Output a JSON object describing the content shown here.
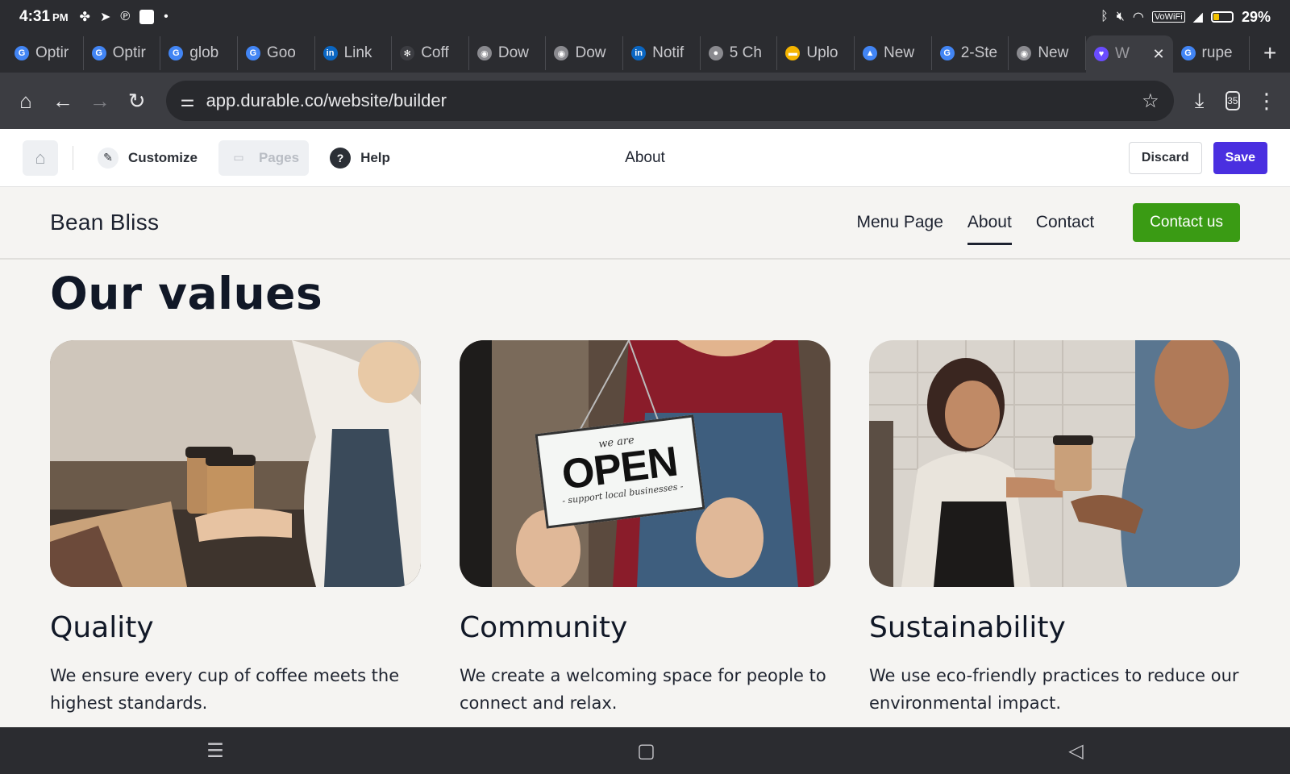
{
  "status": {
    "time": "4:31",
    "ampm": "PM",
    "battery": "29%",
    "wifi_label": "VoWiFi"
  },
  "tabs": [
    {
      "label": "Optir",
      "icon": "google-g-icon",
      "color": "#4285f4"
    },
    {
      "label": "Optir",
      "icon": "google-g-icon",
      "color": "#4285f4"
    },
    {
      "label": "glob",
      "icon": "google-g-icon",
      "color": "#4285f4"
    },
    {
      "label": "Goo",
      "icon": "google-g-icon",
      "color": "#4285f4"
    },
    {
      "label": "Link",
      "icon": "linkedin-icon",
      "color": "#0a66c2"
    },
    {
      "label": "Coff",
      "icon": "leaf-icon",
      "color": "#3c3d42"
    },
    {
      "label": "Dow",
      "icon": "chrome-icon",
      "color": "#8a8a8f"
    },
    {
      "label": "Dow",
      "icon": "chrome-icon",
      "color": "#8a8a8f"
    },
    {
      "label": "Notif",
      "icon": "linkedin-icon",
      "color": "#0a66c2"
    },
    {
      "label": "5 Ch",
      "icon": "globe-icon",
      "color": "#8a8a8f"
    },
    {
      "label": "Uplo",
      "icon": "slides-icon",
      "color": "#f4b400"
    },
    {
      "label": "New",
      "icon": "ads-icon",
      "color": "#4285f4"
    },
    {
      "label": "2-Ste",
      "icon": "google-g-icon",
      "color": "#4285f4"
    },
    {
      "label": "New",
      "icon": "chrome-icon",
      "color": "#8a8a8f"
    },
    {
      "label": "W",
      "icon": "durable-icon",
      "color": "#6a4cff",
      "active": true
    },
    {
      "label": "rupe",
      "icon": "google-g-icon",
      "color": "#4285f4"
    }
  ],
  "address": {
    "url": "app.durable.co/website/builder",
    "tab_count": "35"
  },
  "builder": {
    "customize": "Customize",
    "pages": "Pages",
    "help": "Help",
    "current_page": "About",
    "discard": "Discard",
    "save": "Save"
  },
  "site": {
    "brand": "Bean Bliss",
    "nav": [
      "Menu Page",
      "About",
      "Contact"
    ],
    "active_nav": "About",
    "cta": "Contact us",
    "section_title": "Our values",
    "sign": {
      "top": "we are",
      "main": "OPEN",
      "bottom": "- support local businesses -"
    },
    "cards": [
      {
        "title": "Quality",
        "text": "We ensure every cup of coffee meets the highest standards."
      },
      {
        "title": "Community",
        "text": "We create a welcoming space for people to connect and relax."
      },
      {
        "title": "Sustainability",
        "text": "We use eco-friendly practices to reduce our environmental impact."
      }
    ]
  },
  "colors": {
    "save": "#4a2fe0",
    "cta": "#3a9b14",
    "chrome_bg": "#2b2c30"
  }
}
